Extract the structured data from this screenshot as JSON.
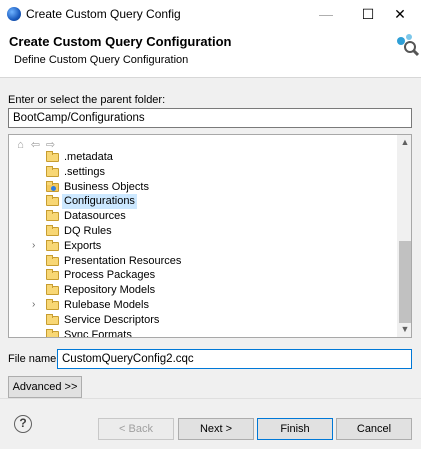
{
  "window": {
    "title": "Create Custom Query Config",
    "minimize": "—",
    "maximize": "☐",
    "close": "✕"
  },
  "header": {
    "title": "Create Custom Query Configuration",
    "subtitle": "Define Custom Query Configuration"
  },
  "parent_folder": {
    "label": "Enter or select the parent folder:",
    "value": "BootCamp/Configurations"
  },
  "tree": {
    "toolbar": {
      "home": "⌂",
      "back": "⇦",
      "forward": "⇨"
    },
    "items": [
      {
        "label": ".metadata",
        "expandable": false,
        "special": false,
        "selected": false
      },
      {
        "label": ".settings",
        "expandable": false,
        "special": false,
        "selected": false
      },
      {
        "label": "Business Objects",
        "expandable": false,
        "special": true,
        "selected": false
      },
      {
        "label": "Configurations",
        "expandable": false,
        "special": false,
        "selected": true
      },
      {
        "label": "Datasources",
        "expandable": false,
        "special": false,
        "selected": false
      },
      {
        "label": "DQ Rules",
        "expandable": false,
        "special": false,
        "selected": false
      },
      {
        "label": "Exports",
        "expandable": true,
        "special": false,
        "selected": false
      },
      {
        "label": "Presentation Resources",
        "expandable": false,
        "special": false,
        "selected": false
      },
      {
        "label": "Process Packages",
        "expandable": false,
        "special": false,
        "selected": false
      },
      {
        "label": "Repository Models",
        "expandable": false,
        "special": false,
        "selected": false
      },
      {
        "label": "Rulebase Models",
        "expandable": true,
        "special": false,
        "selected": false
      },
      {
        "label": "Service Descriptors",
        "expandable": false,
        "special": false,
        "selected": false
      },
      {
        "label": "Sync Formats",
        "expandable": false,
        "special": false,
        "selected": false
      }
    ],
    "expander_glyph": "›"
  },
  "file_name": {
    "label": "File name:",
    "value": "CustomQueryConfig2.cqc"
  },
  "buttons": {
    "advanced": "Advanced >>",
    "back": "< Back",
    "next": "Next >",
    "finish": "Finish",
    "cancel": "Cancel",
    "help": "?"
  },
  "icons": {
    "app": "app-globe-icon",
    "wizard": "wizard-banner-icon",
    "folder": "folder-icon",
    "help": "help-icon"
  },
  "colors": {
    "selection": "#cce8ff",
    "focus_border": "#0078d7",
    "folder": "#f8d775"
  }
}
